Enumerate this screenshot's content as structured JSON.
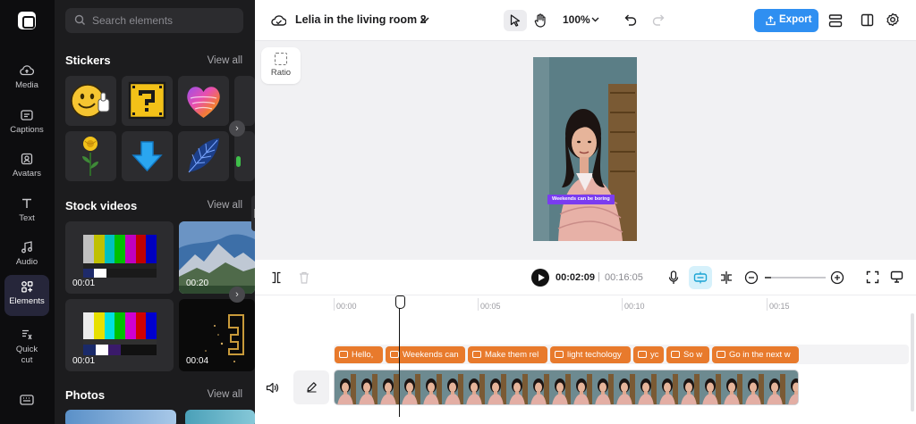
{
  "rail": {
    "items": [
      {
        "label": "Media"
      },
      {
        "label": "Captions"
      },
      {
        "label": "Avatars"
      },
      {
        "label": "Text"
      },
      {
        "label": "Audio"
      },
      {
        "label": "Elements",
        "active": true
      },
      {
        "label": "Quick cut"
      }
    ]
  },
  "panel": {
    "search_placeholder": "Search elements",
    "sections": {
      "stickers": {
        "title": "Stickers",
        "view_all": "View all"
      },
      "stock_videos": {
        "title": "Stock videos",
        "view_all": "View all",
        "durations": [
          "00:01",
          "00:20",
          "00:01",
          "00:04"
        ]
      },
      "photos": {
        "title": "Photos",
        "view_all": "View all"
      }
    }
  },
  "topbar": {
    "project_title": "Lelia in the living room 2",
    "zoom": "100%",
    "export_label": "Export"
  },
  "canvas": {
    "ratio_label": "Ratio",
    "caption_text": "Weekends can be boring"
  },
  "timeline": {
    "current_time": "00:02:09",
    "separator": "|",
    "total_time": "00:16:05",
    "zoom_level": 0.1,
    "ruler": [
      "00:00",
      "00:05",
      "00:10",
      "00:15"
    ],
    "captions": [
      "Hello,",
      "Weekends can",
      "Make them rel",
      "light techology",
      "yc",
      "So w",
      "Go in the next w"
    ]
  },
  "colors": {
    "accent": "#2f8ff1",
    "caption_clip": "#e87a2c",
    "caption_pill": "#7a3cf0",
    "active_rail": "#26263a"
  },
  "icons": [
    "search-icon",
    "cloud-icon",
    "chevron-down-icon",
    "pointer-icon",
    "hand-icon",
    "undo-icon",
    "redo-icon",
    "upload-icon",
    "layers-icon",
    "panel-icon",
    "gear-icon",
    "play-icon",
    "mic-icon",
    "split-icon",
    "zoom-out-icon",
    "zoom-in-icon",
    "fullscreen-icon",
    "monitor-icon",
    "volume-icon",
    "pencil-icon",
    "keyboard-icon"
  ]
}
